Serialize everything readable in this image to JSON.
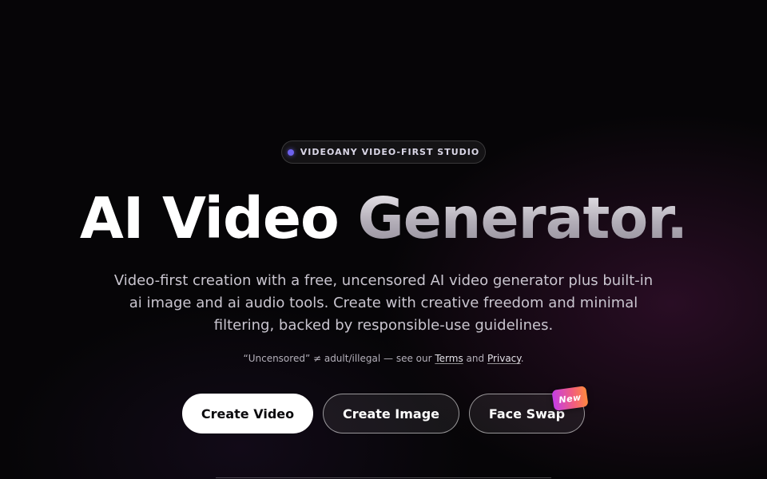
{
  "badge": {
    "text": "VIDEOANY VIDEO-FIRST STUDIO"
  },
  "headline": {
    "part1": "AI Video",
    "part2": "Generator."
  },
  "subtitle": "Video-first creation with a free, uncensored AI video generator plus built-in ai image and ai audio tools. Create with creative freedom and minimal filtering, backed by responsible-use guidelines.",
  "disclaimer": {
    "prefix": "“Uncensored” ≠ adult/illegal — see our",
    "terms_link": "Terms",
    "and": "and",
    "privacy_link": "Privacy",
    "suffix": "."
  },
  "buttons": {
    "create_video": "Create Video",
    "create_image": "Create Image",
    "face_swap": "Face Swap",
    "face_swap_tag": "New"
  },
  "colors": {
    "background": "#060507",
    "accent_dot": "#6d62ee",
    "primary_button": "#ffffff",
    "tag_gradient_start": "#c43ee6",
    "tag_gradient_end": "#ff8a3d"
  }
}
